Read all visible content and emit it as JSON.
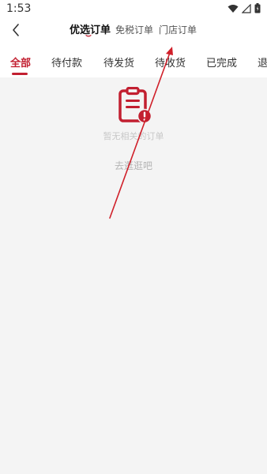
{
  "status_bar": {
    "time": "1:53"
  },
  "header": {
    "order_tabs": [
      {
        "label": "优选订单",
        "active": true
      },
      {
        "label": "免税订单",
        "active": false
      },
      {
        "label": "门店订单",
        "active": false
      }
    ]
  },
  "status_tabs": [
    {
      "label": "全部",
      "active": true
    },
    {
      "label": "待付款",
      "active": false
    },
    {
      "label": "待发货",
      "active": false
    },
    {
      "label": "待收货",
      "active": false
    },
    {
      "label": "已完成",
      "active": false
    },
    {
      "label": "退",
      "active": false
    }
  ],
  "empty_state": {
    "message": "暂无相关的订单",
    "action_label": "去逛逛吧",
    "icon": "clipboard-alert-icon"
  },
  "colors": {
    "accent": "#c21f30",
    "arrow": "#d0202a"
  }
}
